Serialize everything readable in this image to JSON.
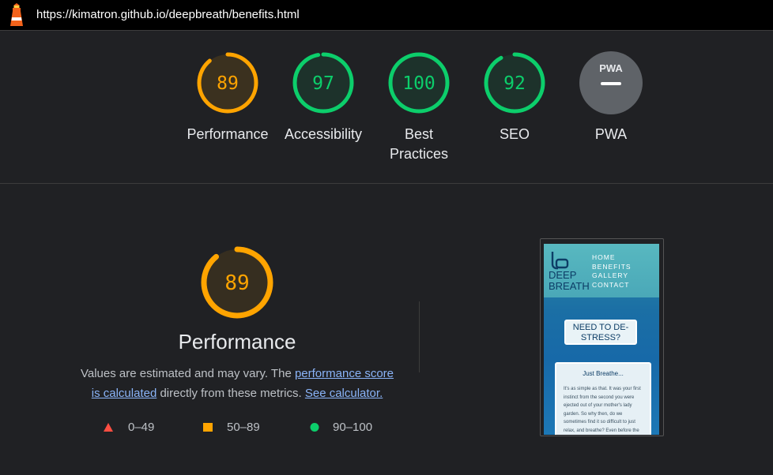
{
  "address_bar": {
    "url": "https://kimatron.github.io/deepbreath/benefits.html"
  },
  "gauges": [
    {
      "label": "Performance",
      "score": "89",
      "value": 89,
      "status": "average"
    },
    {
      "label": "Accessibility",
      "score": "97",
      "value": 97,
      "status": "pass"
    },
    {
      "label": "Best Practices",
      "score": "100",
      "value": 100,
      "status": "pass"
    },
    {
      "label": "SEO",
      "score": "92",
      "value": 92,
      "status": "pass"
    },
    {
      "label": "PWA",
      "badge": "PWA",
      "status": "na"
    }
  ],
  "performance": {
    "score": "89",
    "value": 89,
    "title": "Performance",
    "desc_part1": "Values are estimated and may vary. The ",
    "desc_link1": "performance score is calculated",
    "desc_part2": " directly from these metrics. ",
    "desc_link2": "See calculator."
  },
  "legend": [
    {
      "range": "0–49",
      "shape": "triangle",
      "color": "#ff4e42"
    },
    {
      "range": "50–89",
      "shape": "square",
      "color": "#ffa400"
    },
    {
      "range": "90–100",
      "shape": "circle",
      "color": "#0cce6b"
    }
  ],
  "colors": {
    "pass": "#0cce6b",
    "average": "#ffa400",
    "fail": "#ff4e42",
    "na": "#5f6368"
  },
  "screenshot": {
    "brand_line1": "DEEP",
    "brand_line2": "BREATH",
    "nav": [
      "HOME",
      "BENEFITS",
      "GALLERY",
      "CONTACT"
    ],
    "cta_line1": "NEED TO DE-",
    "cta_line2": "STRESS?",
    "card_title": "Just Breathe...",
    "card_lines": [
      "It's as simple as that. It was your first",
      "instinct from the second you were",
      "ejected out of your mother's lady",
      "garden. So why then, do we",
      "sometimes find it so difficult to just",
      "relax, and breathe? Even before the"
    ]
  }
}
